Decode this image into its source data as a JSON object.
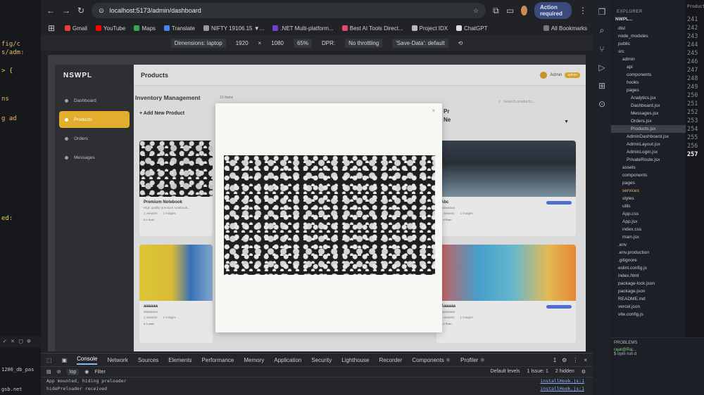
{
  "left_editor": {
    "lines": [
      "fig/c",
      "s/adm:",
      "> {",
      "ns",
      "g ad",
      "ed:"
    ],
    "bottom": [
      "1200_db_pas",
      "gsb.net"
    ]
  },
  "browser": {
    "url": "localhost:5173/admin/dashboard",
    "action_required": "Action required",
    "bookmarks": [
      "Gmail",
      "YouTube",
      "Maps",
      "Translate",
      "NIFTY 19106.15 ▼...",
      ".NET Multi-platform...",
      "Best AI Tools Direct...",
      "Project IDX",
      "ChatGPT"
    ],
    "all_bookmarks": "All Bookmarks",
    "device_bar": {
      "dimensions_label": "Dimensions: laptop",
      "width": "1920",
      "x": "×",
      "height": "1080",
      "zoom": "65%",
      "dpr": "DPR:",
      "throttle": "No throttling",
      "save_data": "'Save-Data': default"
    }
  },
  "app": {
    "brand": "NSWPL",
    "nav": [
      "Dashboard",
      "Products",
      "Orders",
      "Messages"
    ],
    "active_nav": 1,
    "header_title": "Products",
    "admin_name": "Admin",
    "admin_badge": "admin",
    "inventory_title": "Inventory Management",
    "item_count": "10 Items",
    "add_button": "+ Add New Product",
    "search_placeholder": "Search products...",
    "cards": [
      {
        "name": "Premium Notebook",
        "desc": "High quality premium notebook...",
        "variants": "1 variants",
        "images": "1 images",
        "stock": "6.4 Sold"
      },
      {
        "name": "Abc",
        "desc": "aaaaaaaa",
        "variants": "1 variants",
        "images": "1 images",
        "stock": "6.4 Plain"
      },
      {
        "name": "aaaaaa",
        "desc": "aaaaaaaa",
        "variants": "1 variants",
        "images": "1 images",
        "stock": "6.4 plain"
      },
      {
        "name": "Aaaaaa",
        "desc": "aaaaaaaa",
        "variants": "1 variants",
        "images": "1 images",
        "stock": "6.4 Plain"
      }
    ],
    "modal_peek": [
      "Pr",
      "Ne"
    ],
    "modal_close": "×"
  },
  "devtools": {
    "tabs": [
      "Console",
      "Network",
      "Sources",
      "Elements",
      "Performance",
      "Memory",
      "Application",
      "Security",
      "Lighthouse",
      "Recorder",
      "Components ⚛",
      "Profiler ⚛"
    ],
    "issue_count": "1",
    "context": "top",
    "filter": "Filter",
    "levels": "Default levels",
    "issues": "1 Issue: 1",
    "hidden": "2 hidden",
    "logs": [
      {
        "text": "App mounted, hiding preloader",
        "source": "installHook.js:1"
      },
      {
        "text": "hidePreloader received",
        "source": "installHook.js:1"
      }
    ]
  },
  "vscode": {
    "explorer_header": "EXPLORER",
    "root": "NWPL...",
    "tree": [
      "dist",
      "node_modules",
      "public",
      "src",
      "admin",
      "api",
      "components",
      "hooks",
      "pages",
      "Analytics.jsx",
      "Dashboard.jsx",
      "Messages.jsx",
      "Orders.jsx",
      "Products.jsx",
      "AdminDashboard.jsx",
      "AdminLayout.jsx",
      "AdminLogin.jsx",
      "PrivateRoute.jsx",
      "assets",
      "components",
      "pages",
      "services",
      "styles",
      "utils",
      "App.css",
      "App.jsx",
      "index.css",
      "main.jsx",
      ".env",
      ".env.production",
      ".gitignore",
      "eslint.config.js",
      "index.html",
      "package-lock.json",
      "package.json",
      "README.md",
      "vercel.json",
      "vite.config.js"
    ],
    "selected_file": "Products.jsx",
    "line_numbers": [
      "241",
      "242",
      "243",
      "244",
      "245",
      "246",
      "247",
      "248",
      "249",
      "250",
      "251",
      "252",
      "253",
      "254",
      "255",
      "256",
      "257"
    ],
    "current_line": "257",
    "problems": "PROBLEMS",
    "terminal": [
      "rajat@Raj...",
      "$ npm run d"
    ]
  }
}
